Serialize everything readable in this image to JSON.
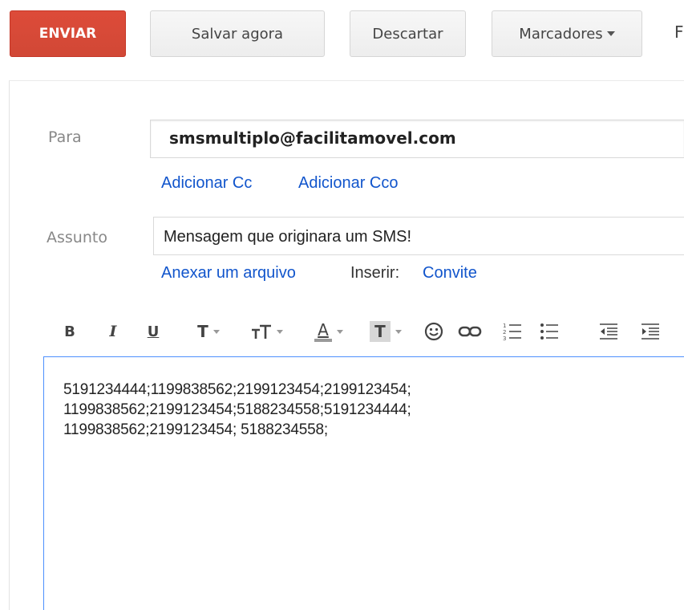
{
  "toolbar": {
    "send_label": "ENVIAR",
    "save_label": "Salvar agora",
    "discard_label": "Descartar",
    "labels_label": "Marcadores",
    "more_partial": "F"
  },
  "fields": {
    "to_label": "Para",
    "to_value": "smsmultiplo@facilitamovel.com",
    "add_cc": "Adicionar Cc",
    "add_bcc": "Adicionar Cco",
    "subject_label": "Assunto",
    "subject_value": "Mensagem que originara um SMS!",
    "attach_file": "Anexar um arquivo",
    "insert_label": "Inserir:",
    "invite_link": "Convite"
  },
  "format_toolbar": {
    "bold": "B",
    "italic": "I",
    "underline": "U",
    "font": "T",
    "text_color": "A",
    "background": "T"
  },
  "body": {
    "lines": [
      "5191234444;1199838562;2199123454;2199123454;",
      "1199838562;2199123454;5188234558;5191234444;",
      "1199838562;2199123454; 5188234558;"
    ]
  },
  "colors": {
    "send_button": "#d14836",
    "link": "#1155cc",
    "editor_focus": "#4d90fe"
  }
}
